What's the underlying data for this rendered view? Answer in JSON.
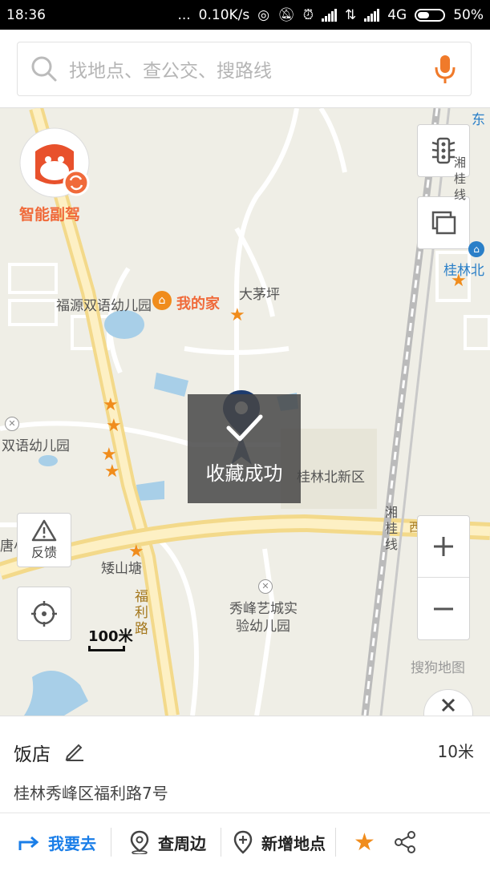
{
  "status_bar": {
    "time": "18:36",
    "dots": "...",
    "speed": "0.10K/s",
    "network": "4G",
    "battery": "50%"
  },
  "search": {
    "placeholder": "找地点、查公交、搜路线"
  },
  "map": {
    "copilot_label": "智能副驾",
    "labels": {
      "kindergarten_1": "福源双语幼儿园",
      "my_home": "我的家",
      "damaoping": "大茅坪",
      "kindergarten_2": "双语幼儿园",
      "guilin_north_district": "桂林北新区",
      "aishan": "矮山塘",
      "fuli_road": "福利路",
      "xiangui_line_top": "湘桂线",
      "xiangui_line_bottom": "湘桂线",
      "xiufeng_kindergarten_line1": "秀峰艺城实",
      "xiufeng_kindergarten_line2": "验幼儿园",
      "guilin_north": "桂林北",
      "east": "东",
      "ring_road": "西二环路",
      "left_edge": "唐小",
      "provider": "搜狗地图"
    },
    "scale": "100米",
    "feedback_label": "反馈",
    "toast": "收藏成功",
    "accent_color": "#f08c1c"
  },
  "poi": {
    "name": "饭店",
    "distance": "10米",
    "address": "桂林秀峰区福利路7号"
  },
  "actions": {
    "go": "我要去",
    "nearby": "查周边",
    "add_place": "新增地点",
    "go_color": "#1a7ee8"
  }
}
